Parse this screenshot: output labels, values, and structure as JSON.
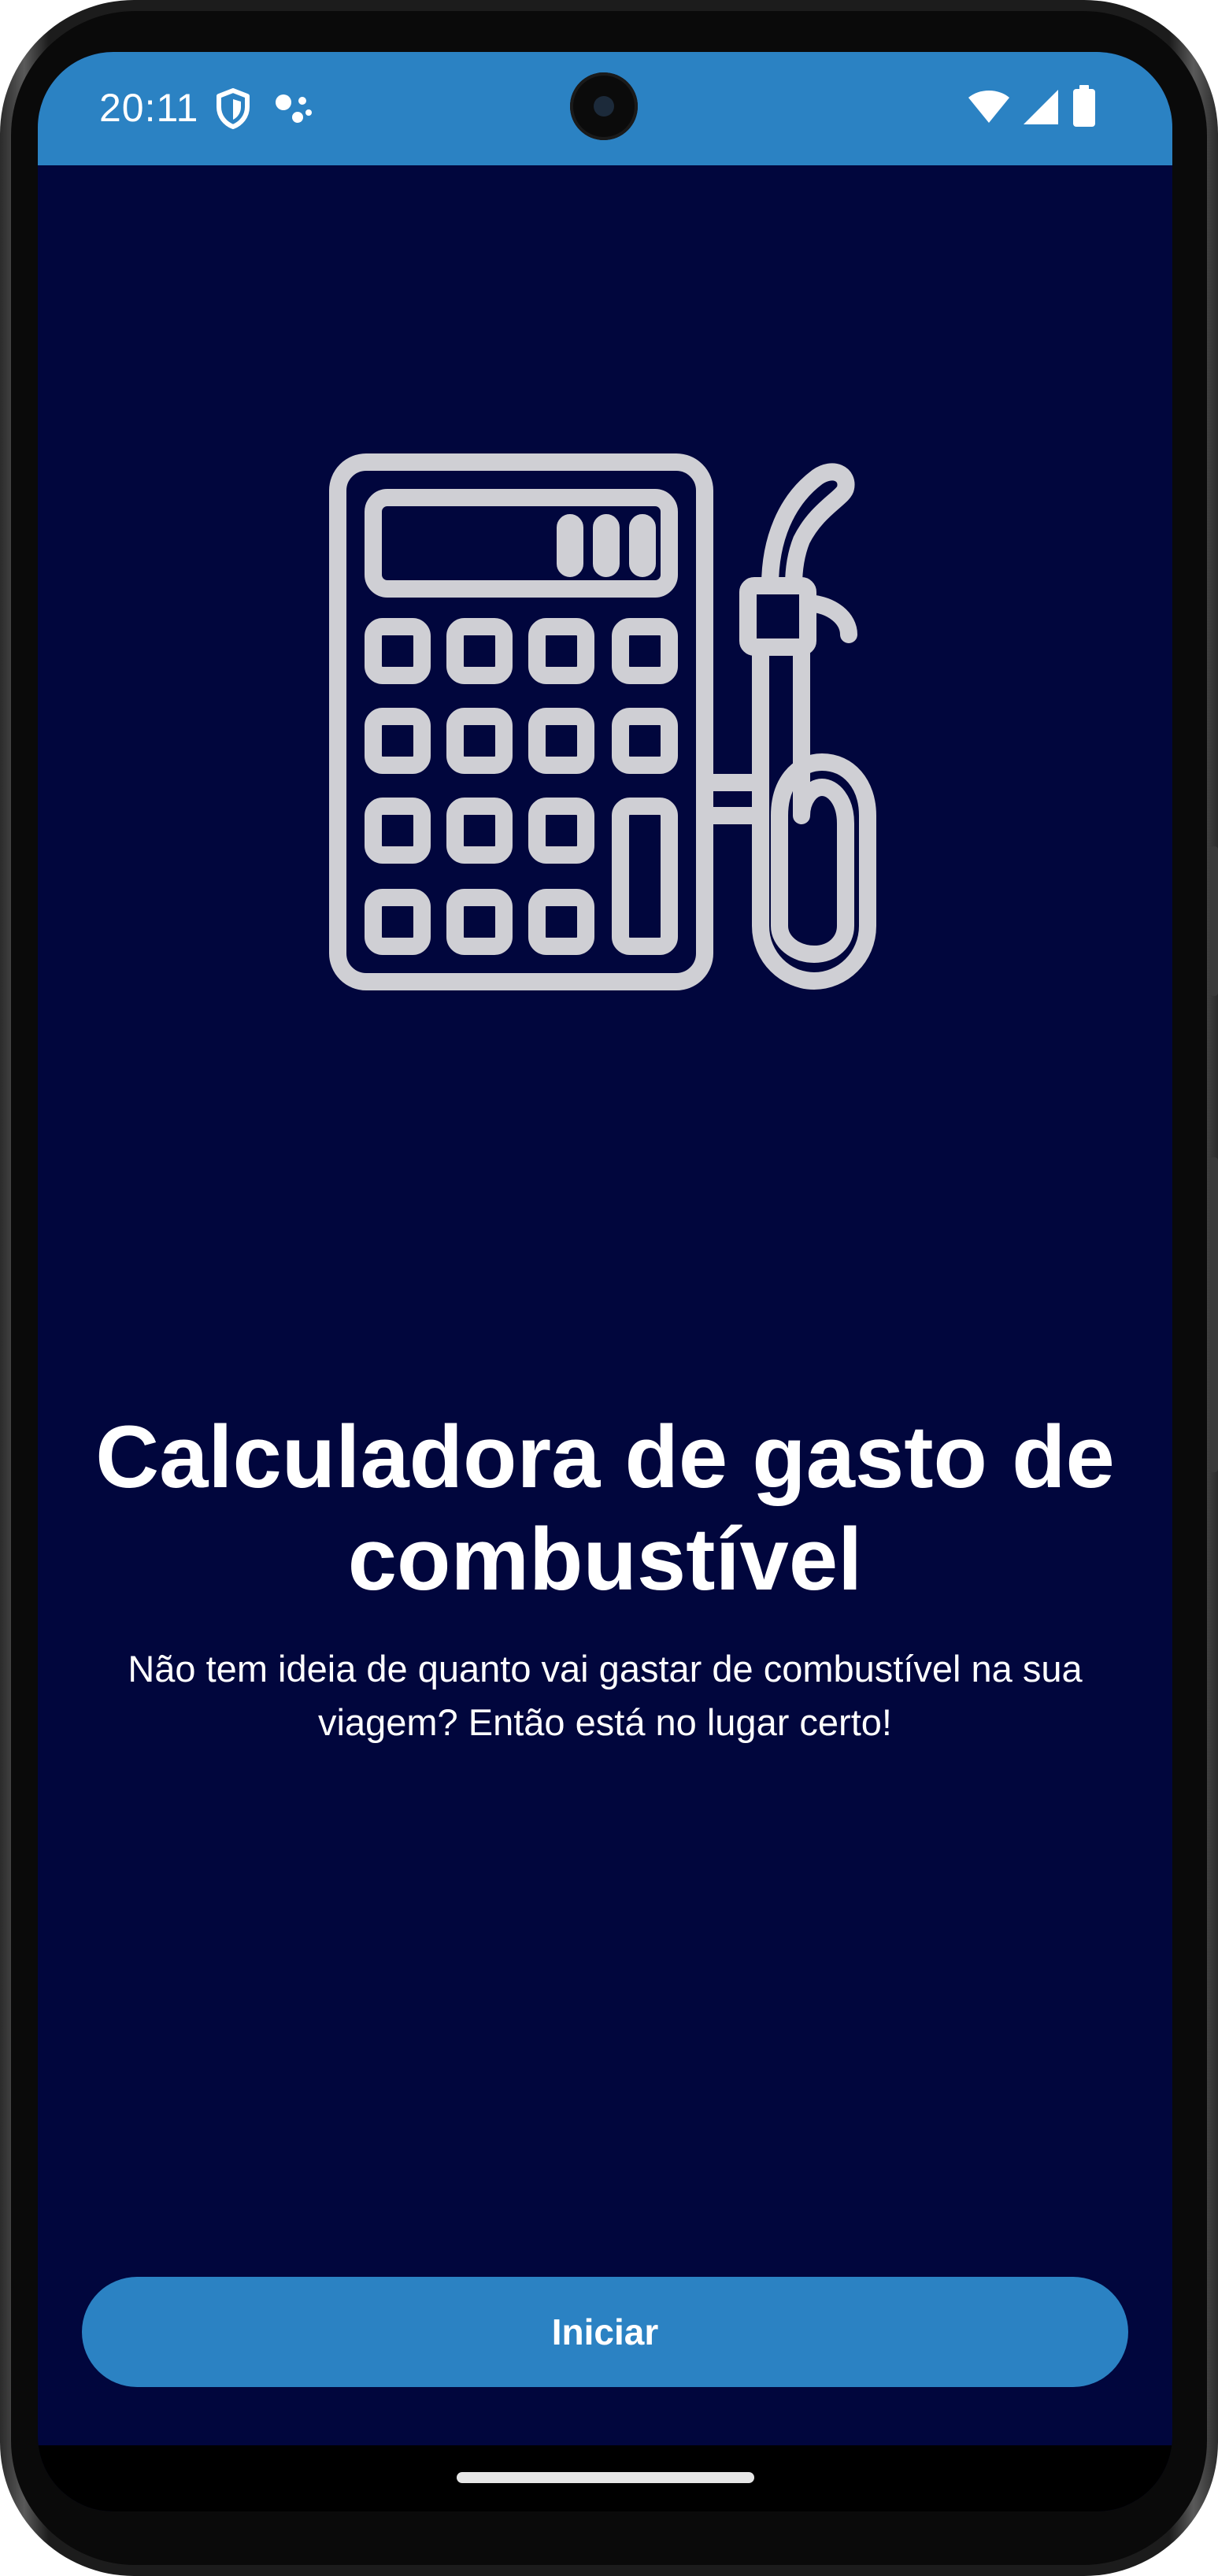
{
  "status_bar": {
    "time": "20:11",
    "icons": [
      "shield-icon",
      "assistant-dots-icon",
      "wifi-icon",
      "signal-icon",
      "battery-icon"
    ],
    "background": "#2b82c3"
  },
  "main": {
    "background": "#01063d",
    "illustration_icon": "calculator-fuel-pump-icon",
    "title": "Calculadora de gasto de combustível",
    "subtitle": "Não tem ideia de quanto vai gastar de combustível na sua viagem? Então está no lugar certo!"
  },
  "actions": {
    "start_label": "Iniciar",
    "accent": "#2b82c3"
  }
}
